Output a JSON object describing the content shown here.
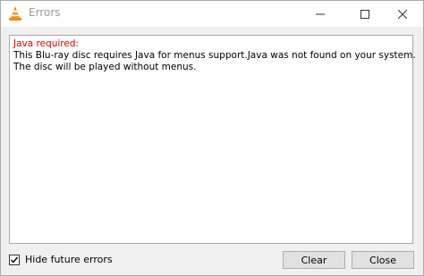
{
  "window": {
    "title": "Errors",
    "app_icon": "vlc-cone-icon"
  },
  "errors": {
    "heading": "Java required:",
    "lines": [
      "This Blu-ray disc requires Java for menus support.Java was not found on your system.",
      "The disc will be played without menus."
    ]
  },
  "footer": {
    "checkbox_label": "Hide future errors",
    "checkbox_checked": true,
    "clear_label": "Clear",
    "close_label": "Close"
  },
  "colors": {
    "error_heading": "#e00000",
    "vlc_orange": "#f48b00"
  }
}
